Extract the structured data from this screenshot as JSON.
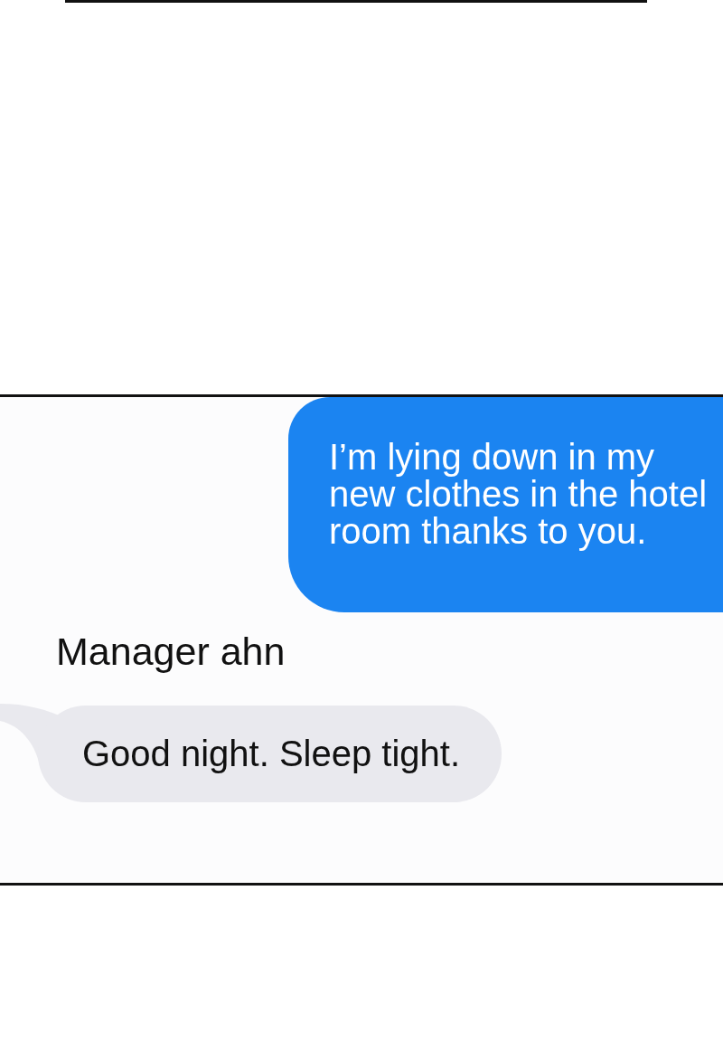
{
  "conversation": {
    "messages": [
      {
        "kind": "sent",
        "text": "I’m lying down in my new clothes in the hotel room thanks to you."
      },
      {
        "kind": "received",
        "sender": "Manager ahn",
        "text": "Good night. Sleep tight."
      }
    ]
  }
}
